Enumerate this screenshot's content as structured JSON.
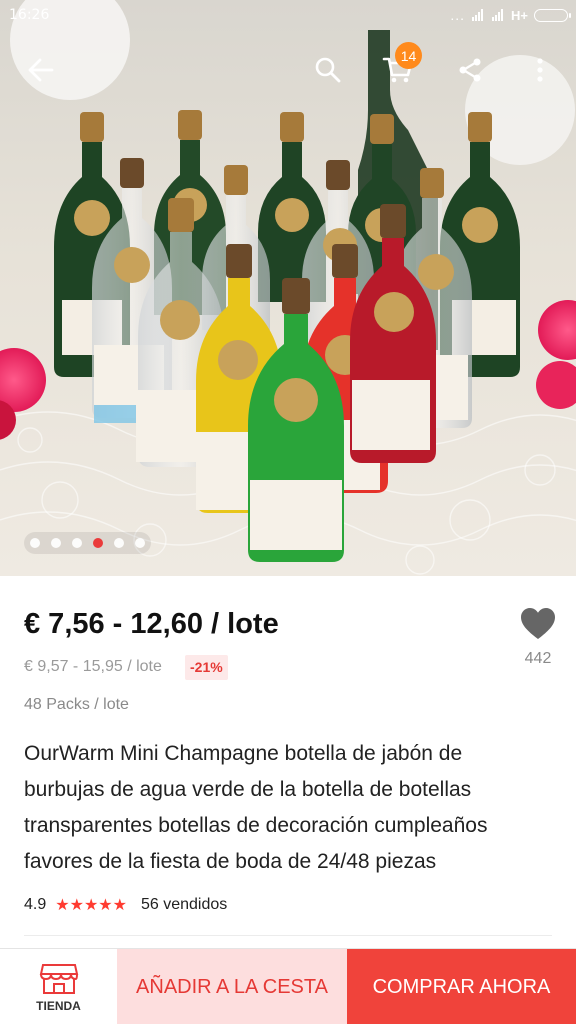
{
  "status_bar": {
    "time": "16:26",
    "dots": "...",
    "network": "H+"
  },
  "nav": {
    "cart_count": "14"
  },
  "carousel": {
    "total": 6,
    "active_index": 3
  },
  "product": {
    "price": "€ 7,56 - 12,60 / lote",
    "original_price": "€ 9,57 - 15,95 / lote",
    "discount": "-21%",
    "wish_count": "442",
    "lot_size": "48 Packs / lote",
    "title_lines": [
      "OurWarm Mini Champagne botella de jabón de",
      "burbujas de agua verde de la botella de botellas",
      "transparentes botellas de decoración cumpleaños",
      "favores de la fiesta de boda de 24/48 piezas"
    ],
    "rating": "4.9",
    "stars": "★★★★★",
    "sold": "56 vendidos"
  },
  "bottom_bar": {
    "store_label": "TIENDA",
    "add_to_cart": "AÑADIR A LA CESTA",
    "buy_now": "COMPRAR AHORA"
  },
  "colors": {
    "accent_red": "#f0433b",
    "discount_red": "#e53935",
    "badge_orange": "#ff8a1c",
    "add_to_cart_bg": "#fddede"
  },
  "icons": [
    "back-arrow-icon",
    "search-icon",
    "cart-icon",
    "share-icon",
    "more-vertical-icon",
    "heart-icon",
    "store-icon"
  ]
}
